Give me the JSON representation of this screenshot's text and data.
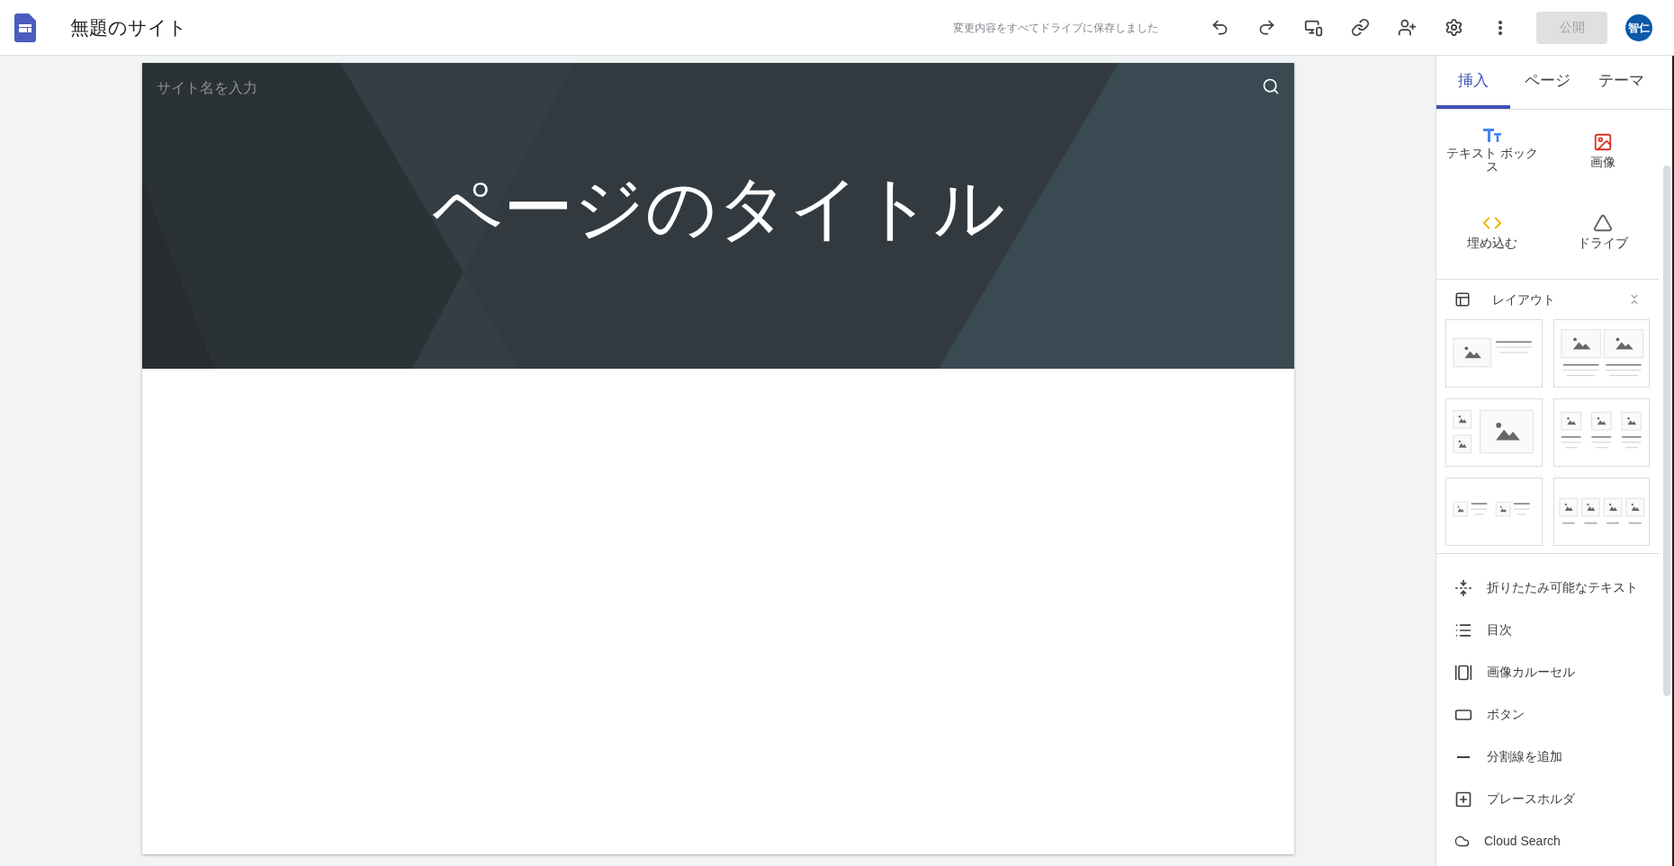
{
  "header": {
    "site_title": "無題のサイト",
    "save_status": "変更内容をすべてドライブに保存しました",
    "publish_button": {
      "label": "公開",
      "disabled": true
    },
    "avatar": "智仁"
  },
  "canvas": {
    "site_name_placeholder": "サイト名を入力",
    "page_title": "ページのタイトル"
  },
  "panel": {
    "tabs": [
      {
        "label": "挿入",
        "selected": true
      },
      {
        "label": "ページ",
        "selected": false
      },
      {
        "label": "テーマ",
        "selected": false
      }
    ],
    "insert_items": [
      {
        "kind": "textbox",
        "label": "テキスト ボックス"
      },
      {
        "kind": "image",
        "label": "画像"
      },
      {
        "kind": "embed",
        "label": "埋め込む"
      },
      {
        "kind": "drive",
        "label": "ドライブ"
      }
    ],
    "layout_section": {
      "title": "レイアウト",
      "expanded": true
    },
    "layouts": [
      {
        "kind": "image-text"
      },
      {
        "kind": "two-images"
      },
      {
        "kind": "gallery"
      },
      {
        "kind": "three-columns"
      },
      {
        "kind": "two-image-text"
      },
      {
        "kind": "four-columns"
      }
    ],
    "components": [
      {
        "kind": "collapsible",
        "label": "折りたたみ可能なテキスト"
      },
      {
        "kind": "toc",
        "label": "目次"
      },
      {
        "kind": "carousel",
        "label": "画像カルーセル"
      },
      {
        "kind": "button",
        "label": "ボタン"
      },
      {
        "kind": "divider",
        "label": "分割線を追加"
      },
      {
        "kind": "placeholder",
        "label": "プレースホルダ"
      },
      {
        "kind": "cloud",
        "label": "Cloud Search"
      }
    ]
  }
}
